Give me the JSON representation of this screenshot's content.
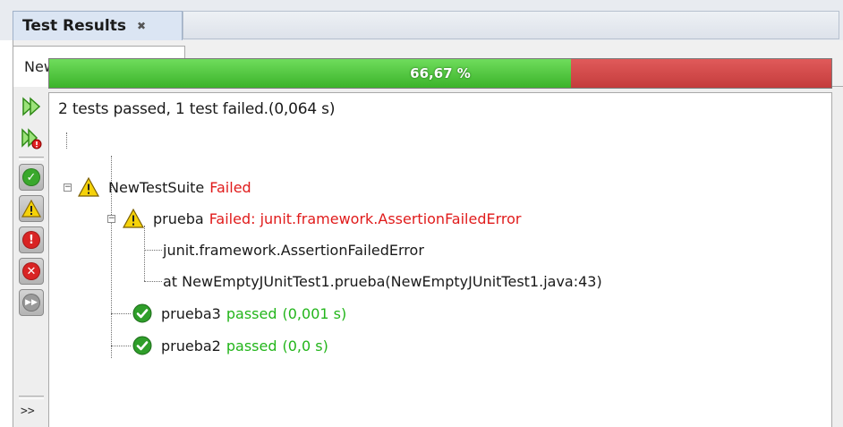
{
  "window": {
    "tab_label": "Test Results",
    "tab_close": "✖"
  },
  "suite_tab": {
    "label": "NewTestSuite",
    "close": "✖"
  },
  "toolbar": {
    "more_label": ">>",
    "buttons": [
      {
        "name": "rerun-icon"
      },
      {
        "name": "rerun-failed-icon"
      },
      {
        "name": "show-passed-icon"
      },
      {
        "name": "show-warnings-icon"
      },
      {
        "name": "show-failures-icon"
      },
      {
        "name": "show-errors-icon"
      },
      {
        "name": "show-aborted-icon"
      }
    ]
  },
  "progress": {
    "percent_label": "66,67 %",
    "passed_fraction": 0.6667,
    "pass_color": "#44bd32",
    "fail_color": "#cc4444"
  },
  "summary": "2 tests passed, 1 test failed.(0,064 s)",
  "tree": {
    "suite": {
      "name": "NewTestSuite",
      "status": "Failed"
    },
    "failed_test": {
      "name": "prueba",
      "status": "Failed: junit.framework.AssertionFailedError"
    },
    "failure_details": [
      "junit.framework.AssertionFailedError",
      "at NewEmptyJUnitTest1.prueba(NewEmptyJUnitTest1.java:43)"
    ],
    "passed_tests": [
      {
        "name": "prueba3",
        "status": "passed",
        "time": "(0,001 s)"
      },
      {
        "name": "prueba2",
        "status": "passed",
        "time": "(0,0 s)"
      }
    ]
  }
}
